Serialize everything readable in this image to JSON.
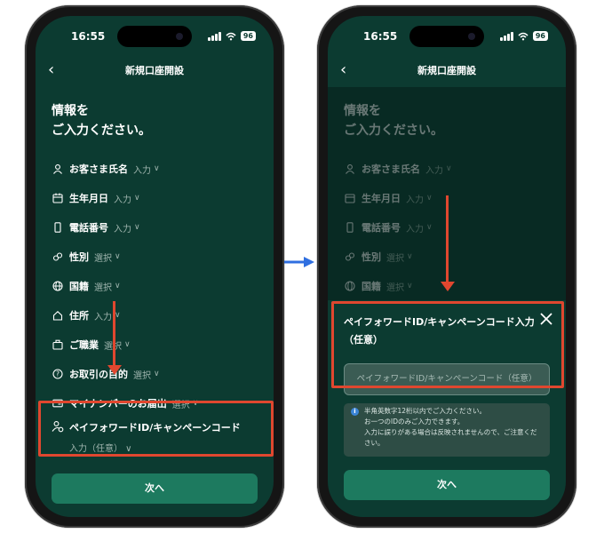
{
  "status": {
    "time": "16:55",
    "battery": "96"
  },
  "header": {
    "back_icon": "chevron-left-icon",
    "title": "新規口座開設"
  },
  "heading": {
    "line1": "情報を",
    "line2": "ご入力ください。"
  },
  "fields": [
    {
      "icon": "person-icon",
      "label": "お客さま氏名",
      "action": "入力"
    },
    {
      "icon": "calendar-icon",
      "label": "生年月日",
      "action": "入力"
    },
    {
      "icon": "phone-icon",
      "label": "電話番号",
      "action": "入力"
    },
    {
      "icon": "gender-icon",
      "label": "性別",
      "action": "選択"
    },
    {
      "icon": "globe-icon",
      "label": "国籍",
      "action": "選択"
    },
    {
      "icon": "home-icon",
      "label": "住所",
      "action": "入力"
    },
    {
      "icon": "briefcase-icon",
      "label": "ご職業",
      "action": "選択"
    },
    {
      "icon": "question-icon",
      "label": "お取引の目的",
      "action": "選択"
    },
    {
      "icon": "id-card-icon",
      "label": "マイナンバーのお届出",
      "action": "選択"
    }
  ],
  "payforward": {
    "icon": "person-gear-icon",
    "label": "ペイフォワードID/キャンペーンコード",
    "action": "入力（任意）"
  },
  "next_button": "次へ",
  "sheet": {
    "title_line1": "ペイフォワードID/キャンペーンコード入力",
    "title_line2": "（任意）",
    "placeholder": "ペイフォワードID/キャンペーンコード（任意）",
    "info_lines": [
      "半角英数字12桁以内でご入力ください。",
      "お一つのIDのみご入力できます。",
      "入力に誤りがある場合は反映されませんので、ご注意ください。"
    ]
  },
  "colors": {
    "background": "#0c3b31",
    "button": "#1d7a5f",
    "highlight": "#e0472f",
    "transition_arrow": "#2f6fe0"
  }
}
